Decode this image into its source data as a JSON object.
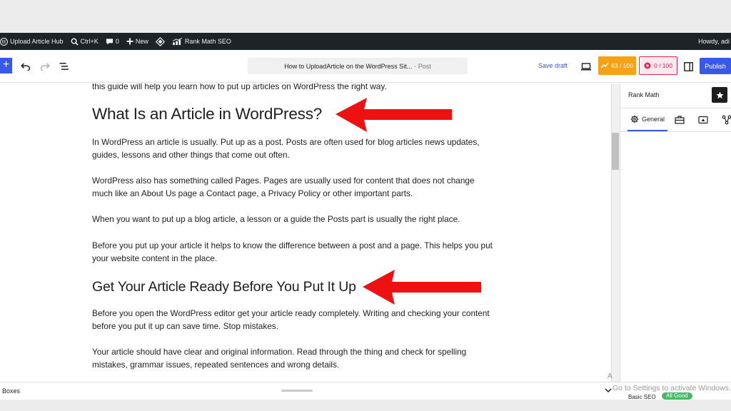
{
  "admin_bar": {
    "site_name": "Upload Article Hub",
    "search_shortcut": "Ctrl+K",
    "comments_count": "0",
    "new_label": "New",
    "rank_math_label": "Rank Math SEO",
    "greeting": "Howdy, adi",
    "icons": [
      "wordpress-icon",
      "search-icon",
      "comment-icon",
      "plus-icon",
      "diamond-icon",
      "rank-math-icon"
    ]
  },
  "toolbar": {
    "add_block_label": "+",
    "doc_title": "How to UploadArticle on the WordPress Sit...",
    "doc_type": "· Post",
    "save_draft": "Save draft",
    "seo_score": "63 / 100",
    "content_score": "0 / 100",
    "publish": "Publish",
    "icons": [
      "undo-icon",
      "redo-icon",
      "document-overview-icon",
      "preview-icon",
      "settings-panel-icon"
    ]
  },
  "editor": {
    "intro_line": "this guide will help you learn how to put up articles on WordPress the right way.",
    "heading_1": "What Is an Article in WordPress?",
    "paragraphs_1": [
      "In WordPress an article is usually. Put up as a post. Posts are often used for blog articles news updates, guides, lessons and other things that come out often.",
      "WordPress also has something called Pages. Pages are usually used for content that does not change much like an About Us page a Contact page, a Privacy Policy or other important parts.",
      "When you want to put up a blog article, a lesson or a guide the Posts part is usually the right place.",
      "Before you put up your article it helps to know the difference between a post and a page. This helps you put your website content in the place."
    ],
    "heading_2": "Get Your Article Ready Before You Put It Up",
    "paragraphs_2": [
      "Before you open the WordPress editor get your article ready completely. Writing and checking your content before you put it up can save time. Stop mistakes.",
      "Your article should have clear and original information. Read through the thing and check for spelling mistakes, grammar issues, repeated sentences and wrong details."
    ],
    "arrow_color": "#ee1111"
  },
  "sidebar": {
    "title": "Rank Math",
    "active_tab": "General",
    "tab_icons": [
      "gear-icon",
      "briefcase-icon",
      "social-icon",
      "schema-icon"
    ]
  },
  "bottom_bar": {
    "label": "Boxes",
    "ax_text": "A",
    "watermark": "Go to Settings to activate Windows.",
    "peek_label": "Basic SEO",
    "peek_badge": "All Good"
  },
  "colors": {
    "admin_bar_bg": "#1d2327",
    "wp_blue": "#3858e9",
    "seo_score_bg": "#f6a118",
    "content_score_border": "#e0245e"
  }
}
